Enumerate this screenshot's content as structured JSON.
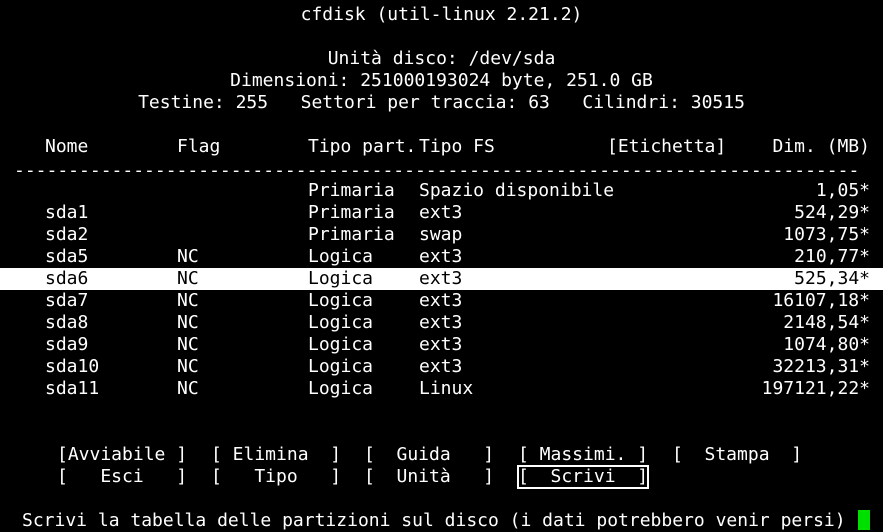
{
  "app": {
    "title": "cfdisk (util-linux 2.21.2)"
  },
  "disk_info": {
    "unit": "Unità disco: /dev/sda",
    "size": "Dimensioni: 251000193024 byte, 251.0 GB",
    "geometry": "Testine: 255   Settori per traccia: 63   Cilindri: 30515"
  },
  "table": {
    "headers": {
      "name": "Nome",
      "flag": "Flag",
      "type": "Tipo part.",
      "fs": "Tipo FS",
      "label": "[Etichetta]",
      "size": "Dim. (MB)"
    },
    "separator": "------------------------------------------------------------------------------",
    "selected_index": 4,
    "rows": [
      {
        "name": "",
        "flag": "",
        "type": "Primaria",
        "fs": "Spazio disponibile",
        "size": "1,05*"
      },
      {
        "name": "sda1",
        "flag": "",
        "type": "Primaria",
        "fs": "ext3",
        "size": "524,29*"
      },
      {
        "name": "sda2",
        "flag": "",
        "type": "Primaria",
        "fs": "swap",
        "size": "1073,75*"
      },
      {
        "name": "sda5",
        "flag": "NC",
        "type": "Logica",
        "fs": "ext3",
        "size": "210,77*"
      },
      {
        "name": "sda6",
        "flag": "NC",
        "type": "Logica",
        "fs": "ext3",
        "size": "525,34*"
      },
      {
        "name": "sda7",
        "flag": "NC",
        "type": "Logica",
        "fs": "ext3",
        "size": "16107,18*"
      },
      {
        "name": "sda8",
        "flag": "NC",
        "type": "Logica",
        "fs": "ext3",
        "size": "2148,54*"
      },
      {
        "name": "sda9",
        "flag": "NC",
        "type": "Logica",
        "fs": "ext3",
        "size": "1074,80*"
      },
      {
        "name": "sda10",
        "flag": "NC",
        "type": "Logica",
        "fs": "ext3",
        "size": "32213,31*"
      },
      {
        "name": "sda11",
        "flag": "NC",
        "type": "Logica",
        "fs": "Linux",
        "size": "197121,22*"
      }
    ]
  },
  "menu": {
    "bootable": "[Avviabile ]",
    "delete": "[ Elimina  ]",
    "help": "[  Guida   ]",
    "maximize": "[ Massimi. ]",
    "print": "[  Stampa  ]",
    "quit": "[   Esci   ]",
    "type": "[   Tipo   ]",
    "units": "[  Unità   ]",
    "write": "[  Scrivi  ]"
  },
  "status": {
    "message": "Scrivi la tabella delle partizioni sul disco (i dati potrebbero venir persi)"
  },
  "colors": {
    "background": "#000000",
    "foreground": "#ffffff",
    "cursor": "#00e000"
  }
}
